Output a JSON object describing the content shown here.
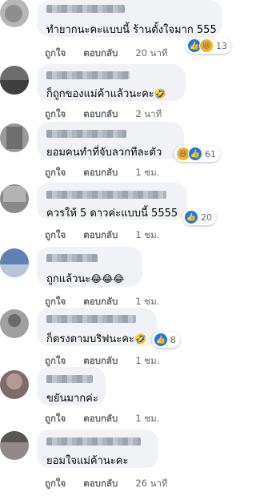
{
  "comments": [
    {
      "text": "ทำยากนะคะแบบนี้ ร้านตั้งใจมาก 555",
      "like": "ถูกใจ",
      "reply": "ตอบกลับ",
      "time": "20 นาที",
      "count": "13"
    },
    {
      "text": "ก็ถูกของแม่ค้าแล้วนะคะ",
      "like": "ถูกใจ",
      "reply": "ตอบกลับ",
      "time": "2 นาที",
      "emoji": "🤣"
    },
    {
      "text": "ยอมคนทำที่จับลวกทีละตัว",
      "like": "ถูกใจ",
      "reply": "ตอบกลับ",
      "time": "1 ชม.",
      "count": "61"
    },
    {
      "text": "ควรให้ 5 ดาวค่ะแบบนี้ 5555",
      "like": "ถูกใจ",
      "reply": "ตอบกลับ",
      "time": "1 ชม.",
      "count": "20"
    },
    {
      "text": "ถูกแล้วนะ",
      "like": "ถูกใจ",
      "reply": "ตอบกลับ",
      "time": "1 ชม.",
      "emoji": "😂😂😂"
    },
    {
      "text": "ก็ตรงตามบริฟนะคะ",
      "like": "ถูกใจ",
      "reply": "ตอบกลับ",
      "time": "1 ชม.",
      "count": "8",
      "emoji": "🤣"
    },
    {
      "text": "ขยันมากค่ะ",
      "like": "ถูกใจ",
      "reply": "ตอบกลับ",
      "time": "1 ชม."
    },
    {
      "text": "ยอมใจแม่ค้านะคะ",
      "like": "ถูกใจ",
      "reply": "ตอบกลับ",
      "time": "26 นาที"
    }
  ],
  "icons": {
    "like": "like-reaction-icon",
    "haha": "haha-reaction-icon"
  },
  "colors": {
    "like": "#1877f2",
    "bubble": "#f0f2f5",
    "meta": "#65676b"
  }
}
